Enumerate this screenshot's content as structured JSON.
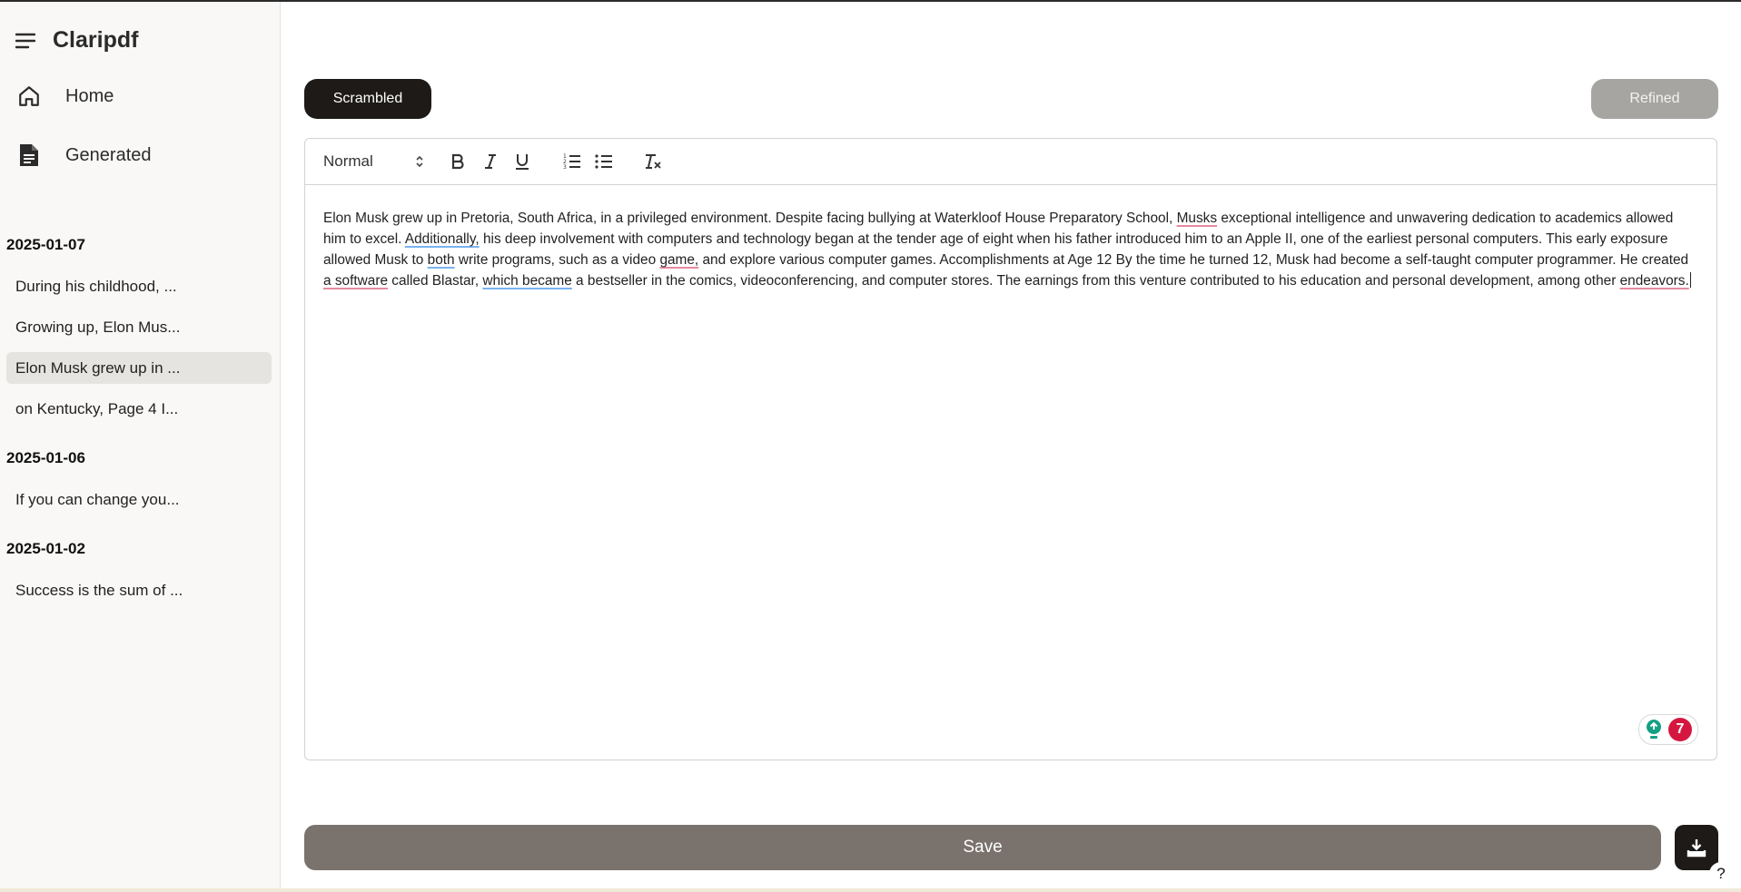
{
  "app": {
    "name": "Claripdf"
  },
  "sidebar": {
    "nav": [
      {
        "label": "Home",
        "icon": "home-icon"
      },
      {
        "label": "Generated",
        "icon": "document-icon"
      }
    ],
    "groups": [
      {
        "date": "2025-01-07",
        "items": [
          {
            "label": "During his childhood, ..."
          },
          {
            "label": "Growing up, Elon Mus..."
          },
          {
            "label": "Elon Musk grew up in ...",
            "active": true
          },
          {
            "label": "on Kentucky, Page 4 I..."
          }
        ]
      },
      {
        "date": "2025-01-06",
        "items": [
          {
            "label": "If you can change you..."
          }
        ]
      },
      {
        "date": "2025-01-02",
        "items": [
          {
            "label": "Success is the sum of ..."
          }
        ]
      }
    ]
  },
  "tabs": {
    "scrambled": "Scrambled",
    "refined": "Refined",
    "active": "scrambled"
  },
  "toolbar": {
    "format_select": "Normal",
    "buttons": [
      "bold-icon",
      "italic-icon",
      "underline-icon",
      "ordered-list-icon",
      "bullet-list-icon",
      "clear-format-icon"
    ]
  },
  "editor": {
    "segments": [
      {
        "t": "Elon Musk grew up in Pretoria, South Africa, in a privileged environment. Despite facing bullying at Waterkloof House Preparatory School, "
      },
      {
        "t": "Musks",
        "u": "red"
      },
      {
        "t": " exceptional intelligence and unwavering dedication to academics allowed him to excel. "
      },
      {
        "t": "Additionally,",
        "u": "blue"
      },
      {
        "t": " his deep involvement with computers and technology began at the tender age of eight when his father introduced him to an Apple II, one of the earliest personal computers. This early exposure allowed Musk to "
      },
      {
        "t": "both",
        "u": "blue"
      },
      {
        "t": " write programs, such as a video "
      },
      {
        "t": "game,",
        "u": "red"
      },
      {
        "t": " and explore various computer games. Accomplishments at Age 12 By the time he turned 12, Musk had become a self-taught computer programmer. He created "
      },
      {
        "t": "a software",
        "u": "red"
      },
      {
        "t": " called Blastar, "
      },
      {
        "t": "which became",
        "u": "blue"
      },
      {
        "t": " a bestseller in the comics, videoconferencing, and computer stores. The earnings from this venture contributed to his education and personal development, among other "
      },
      {
        "t": "endeavors.",
        "u": "red"
      }
    ],
    "grammar_count": "7"
  },
  "actions": {
    "save": "Save",
    "help": "?"
  }
}
